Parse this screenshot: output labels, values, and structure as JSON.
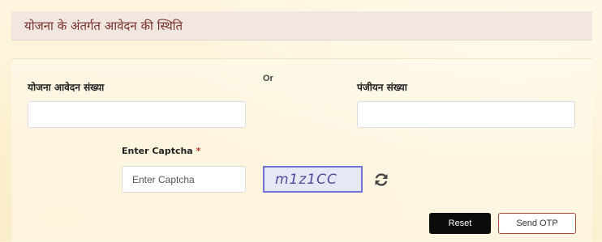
{
  "header": {
    "title": "योजना के अंतर्गत आवेदन की स्थिति"
  },
  "form": {
    "application_number_label": "योजना आवेदन संख्या",
    "application_number_value": "",
    "or_label": "Or",
    "registration_number_label": "पंजीयन संख्या",
    "registration_number_value": "",
    "captcha_label": "Enter Captcha",
    "captcha_required_mark": "*",
    "captcha_placeholder": "Enter Captcha",
    "captcha_image_text": "m1z1CC",
    "refresh_icon": "refresh-icon"
  },
  "actions": {
    "reset_label": "Reset",
    "send_otp_label": "Send OTP"
  },
  "colors": {
    "header_text": "#7a2e2a",
    "reset_bg": "#0b0b0b",
    "otp_border": "#b24a3d",
    "captcha_border": "#6f74d6"
  }
}
